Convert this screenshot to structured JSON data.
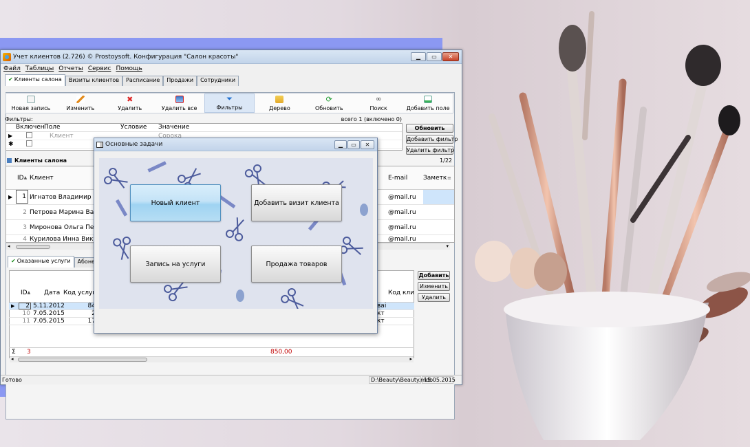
{
  "main_window": {
    "title": "Учет клиентов (2.726) © Prostoysoft. Конфигурация \"Салон красоты\"",
    "buttons": {
      "minimize": "▁",
      "maximize": "▭",
      "close": "✕"
    },
    "menu": [
      "Файл",
      "Таблицы",
      "Отчеты",
      "Сервис",
      "Помощь"
    ],
    "tabs": [
      "Клиенты салона",
      "Визиты клиентов",
      "Расписание",
      "Продажи",
      "Сотрудники"
    ],
    "toolbar": [
      "Новая запись",
      "Изменить",
      "Удалить",
      "Удалить все",
      "Фильтры",
      "Дерево",
      "Обновить",
      "Поиск",
      "Добавить поле"
    ]
  },
  "filters": {
    "label": "Фильтры:",
    "count": "всего 1 (включено 0)",
    "columns": [
      "Включен",
      "Поле",
      "Условие",
      "Значение"
    ],
    "row": {
      "field": "Клиент",
      "value": "Сорока"
    },
    "buttons": {
      "refresh": "Обновить",
      "add": "Добавить фильтр",
      "remove": "Удалить фильтр"
    }
  },
  "clients": {
    "title": "Клиенты салона",
    "count": "1/22",
    "columns": {
      "id": "ID",
      "client": "Клиент",
      "email": "E-mail",
      "note": "Заметк"
    },
    "rows": [
      {
        "id": "1",
        "name": "Игнатов Владимир Иг",
        "email": "@mail.ru"
      },
      {
        "id": "2",
        "name": "Петрова Марина Вал",
        "email": "@mail.ru"
      },
      {
        "id": "3",
        "name": "Миронова Ольга Петр",
        "email": "@mail.ru"
      },
      {
        "id": "4",
        "name": "Курилова Инна Викто",
        "email": "@mail.ru"
      }
    ]
  },
  "services": {
    "tabs": [
      "Оказанные услуги",
      "Абонемент"
    ],
    "columns": {
      "id": "ID",
      "date": "Дата",
      "code": "Код услуги",
      "code2": "Код клие"
    },
    "rows": [
      {
        "id": "2",
        "date": "5.11.2012",
        "code": "84",
        "tail": "ваі"
      },
      {
        "id": "10",
        "date": "7.05.2015",
        "code": "2",
        "tail": "кт"
      },
      {
        "id": "11",
        "date": "7.05.2015",
        "code": "17",
        "tail": "кт"
      }
    ],
    "sum_symbol": "Σ",
    "sum_count": "3",
    "sum_total": "850,00",
    "buttons": {
      "add": "Добавить",
      "edit": "Изменить",
      "delete": "Удалить"
    }
  },
  "status": {
    "left": "Готово",
    "path": "D:\\Beauty\\Beauty.mdb",
    "date": "15.05.2015"
  },
  "dialog": {
    "title": "Основные задачи",
    "buttons": [
      "Новый клиент",
      "Добавить визит клиента",
      "Запись на услуги",
      "Продажа товаров"
    ]
  },
  "colors": {
    "accent": "#8b98f2",
    "selected_row": "#cfe5fb",
    "sum_red": "#c00000"
  }
}
